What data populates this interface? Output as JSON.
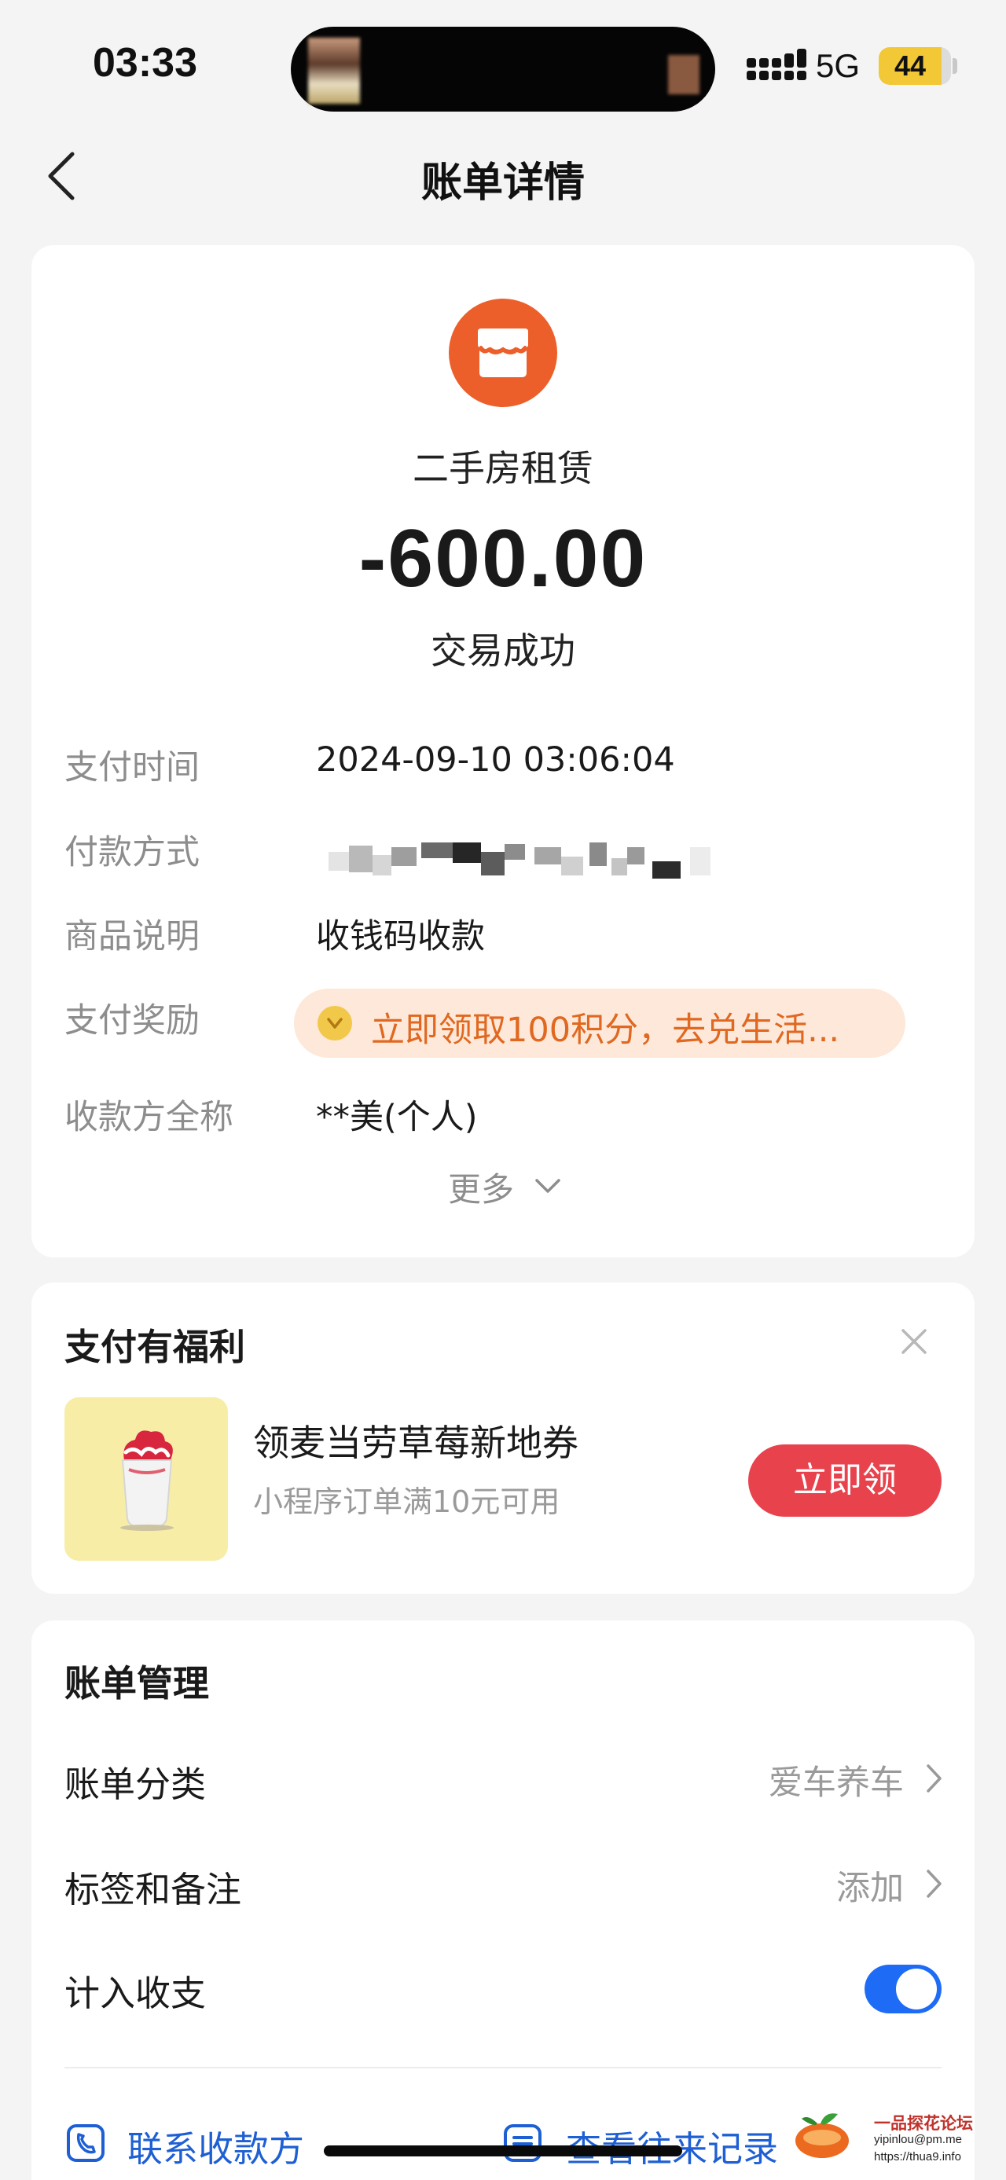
{
  "status_bar": {
    "time": "03:33",
    "network": "5G",
    "battery_level": "44",
    "battery_fraction": 0.44
  },
  "nav": {
    "title": "账单详情"
  },
  "transaction": {
    "merchant_name": "二手房租赁",
    "amount": "-600.00",
    "status": "交易成功",
    "details": {
      "pay_time_label": "支付时间",
      "pay_time_value": "2024-09-10 03:06:04",
      "pay_method_label": "付款方式",
      "product_label": "商品说明",
      "product_value": "收钱码收款",
      "reward_label": "支付奖励",
      "reward_text": "立即领取100积分，去兑生活...",
      "payee_label": "收款方全称",
      "payee_value": "**美(个人)"
    },
    "more_label": "更多"
  },
  "promo": {
    "title": "支付有福利",
    "item_name": "领麦当劳草莓新地券",
    "item_desc": "小程序订单满10元可用",
    "claim_button": "立即领"
  },
  "manage": {
    "title": "账单管理",
    "category_label": "账单分类",
    "category_value": "爱车养车",
    "tag_label": "标签和备注",
    "tag_value": "添加",
    "include_label": "计入收支",
    "include_enabled": true,
    "contact_payee": "联系收款方",
    "view_history": "查看往来记录"
  },
  "watermark": {
    "title": "一品探花论坛",
    "line1": "yipinlou@pm.me",
    "line2": "https://thua9.info"
  },
  "colors": {
    "brand_orange": "#ec5f2a",
    "accent_blue": "#1e6cf5",
    "claim_red": "#e8424d",
    "reward_bg": "#fde8d9"
  }
}
